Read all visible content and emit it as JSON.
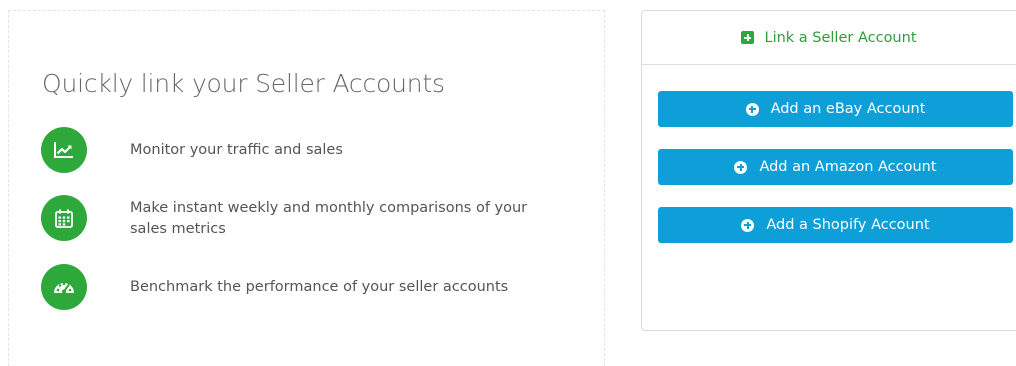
{
  "intro": {
    "title": "Quickly link your Seller Accounts",
    "features": [
      {
        "icon": "line-chart-icon",
        "text": "Monitor your traffic and sales"
      },
      {
        "icon": "calendar-icon",
        "text": "Make instant weekly and monthly comparisons of your sales metrics"
      },
      {
        "icon": "dashboard-gauge-icon",
        "text": "Benchmark the performance of your seller accounts"
      }
    ]
  },
  "link_panel": {
    "header_label": "Link a Seller Account",
    "header_icon": "plus-square-icon",
    "buttons": [
      {
        "label": "Add an eBay Account",
        "icon": "plus-circle-icon"
      },
      {
        "label": "Add an Amazon Account",
        "icon": "plus-circle-icon"
      },
      {
        "label": "Add a Shopify Account",
        "icon": "plus-circle-icon"
      }
    ]
  },
  "colors": {
    "green": "#2fa83b",
    "blue": "#0f9fd8",
    "text": "#555555"
  }
}
